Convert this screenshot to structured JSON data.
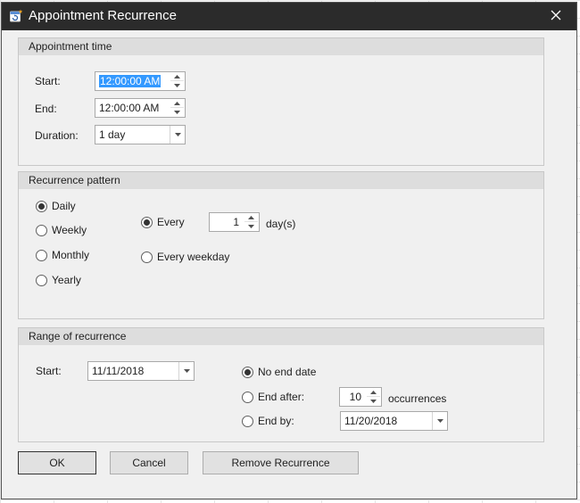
{
  "window": {
    "title": "Appointment Recurrence",
    "close_icon": "close-icon",
    "app_icon": "recurrence-calendar-icon"
  },
  "appointment_time": {
    "header": "Appointment time",
    "start_label": "Start:",
    "start_value": "12:00:00 AM",
    "end_label": "End:",
    "end_value": "12:00:00 AM",
    "duration_label": "Duration:",
    "duration_value": "1 day"
  },
  "recurrence_pattern": {
    "header": "Recurrence pattern",
    "options": [
      "Daily",
      "Weekly",
      "Monthly",
      "Yearly"
    ],
    "selected": "Daily",
    "daily": {
      "every_label": "Every",
      "every_value": "1",
      "unit_label": "day(s)",
      "every_weekday_label": "Every weekday",
      "selected": "Every"
    }
  },
  "range_of_recurrence": {
    "header": "Range of recurrence",
    "start_label": "Start:",
    "start_value": "11/11/2018",
    "no_end_label": "No end date",
    "end_after_label": "End after:",
    "end_after_value": "10",
    "occurrences_label": "occurrences",
    "end_by_label": "End by:",
    "end_by_value": "11/20/2018",
    "selected": "No end date"
  },
  "buttons": {
    "ok": "OK",
    "cancel": "Cancel",
    "remove": "Remove Recurrence"
  },
  "colors": {
    "titlebar": "#2b2b2b",
    "dialog_bg": "#f0f0f0",
    "selection": "#3399ff",
    "group_header": "#dddddd"
  }
}
